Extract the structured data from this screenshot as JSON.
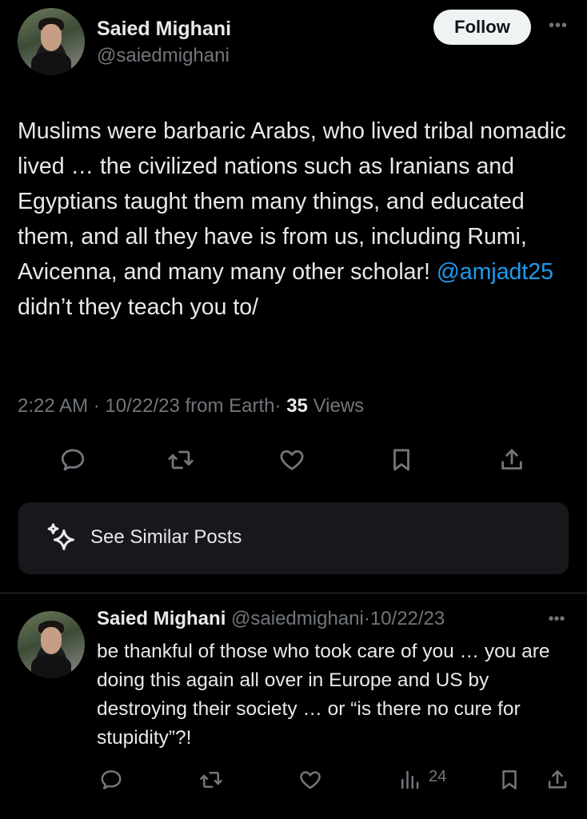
{
  "main_post": {
    "author_name": "Saied Mighani",
    "author_handle": "@saiedmighani",
    "follow_label": "Follow",
    "text_before_mention": "Muslims were barbaric Arabs, who lived tribal nomadic lived … the civilized nations such as Iranians and Egyptians taught them many things, and educated them, and all they have is from us, including Rumi, Avicenna, and many many other scholar! ",
    "mention": "@amjadt25",
    "text_after_mention": " didn’t they teach you to/",
    "time": "2:22 AM",
    "date": "10/22/23",
    "source": "from Earth",
    "views_count": "35",
    "views_label": "Views",
    "separator": "·"
  },
  "similar_posts": {
    "label": "See Similar Posts"
  },
  "reply": {
    "author_name": "Saied Mighani",
    "author_handle": "@saiedmighani",
    "date": "10/22/23",
    "separator": "·",
    "text": "be thankful of those who took care of you … you are doing this again all over in Europe and US by destroying their society … or “is there no cure for stupidity”?!",
    "views_count": "24"
  },
  "colors": {
    "background": "#000000",
    "text": "#e7e9ea",
    "secondary": "#71767b",
    "link": "#1d9bf0",
    "card": "#16181c"
  },
  "icons": {
    "reply": "reply-icon",
    "repost": "repost-icon",
    "like": "heart-icon",
    "bookmark": "bookmark-icon",
    "share": "share-icon",
    "views": "views-chart-icon",
    "more": "more-dots-icon",
    "sparkle": "sparkle-icon"
  }
}
